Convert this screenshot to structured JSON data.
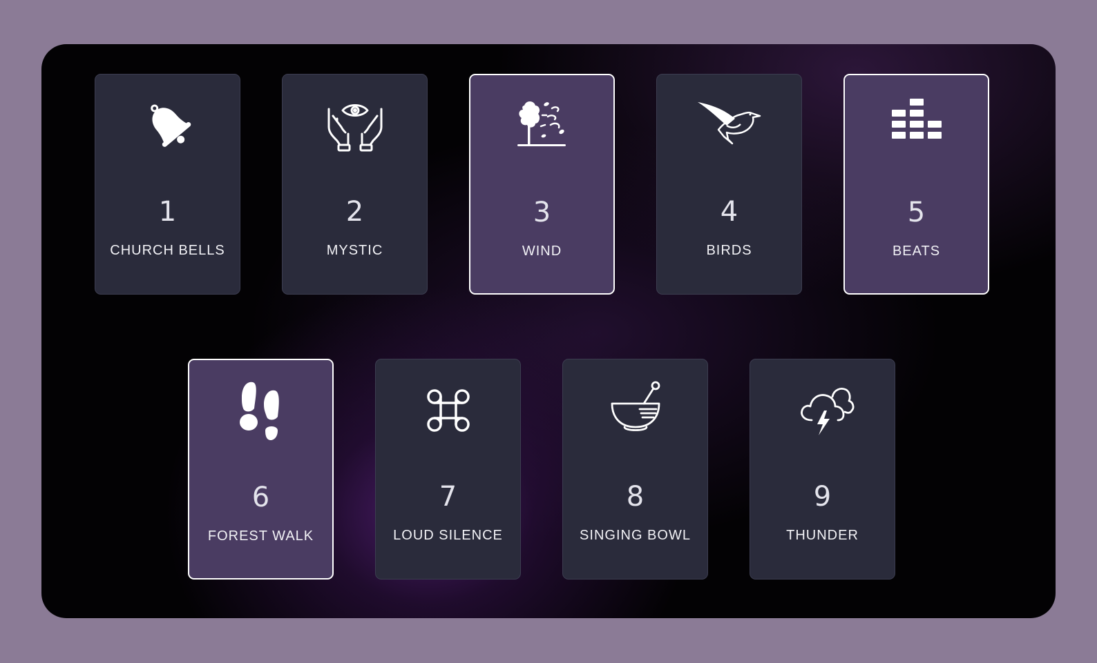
{
  "colors": {
    "page_background": "#8b7b96",
    "pad_default": "#2a2b3b",
    "pad_active": "#4a3c62",
    "pad_active_border": "#ffffff",
    "text": "#ffffff"
  },
  "pads": [
    {
      "number": "1",
      "label": "CHURCH BELLS",
      "icon": "bell-icon",
      "active": false
    },
    {
      "number": "2",
      "label": "MYSTIC",
      "icon": "hands-eye-icon",
      "active": false
    },
    {
      "number": "3",
      "label": "WIND",
      "icon": "wind-tree-icon",
      "active": true
    },
    {
      "number": "4",
      "label": "BIRDS",
      "icon": "dove-icon",
      "active": false
    },
    {
      "number": "5",
      "label": "BEATS",
      "icon": "equalizer-icon",
      "active": true
    },
    {
      "number": "6",
      "label": "FOREST WALK",
      "icon": "footprints-icon",
      "active": true
    },
    {
      "number": "7",
      "label": "LOUD SILENCE",
      "icon": "command-icon",
      "active": false
    },
    {
      "number": "8",
      "label": "SINGING BOWL",
      "icon": "mortar-pestle-icon",
      "active": false
    },
    {
      "number": "9",
      "label": "THUNDER",
      "icon": "thunder-cloud-icon",
      "active": false
    }
  ]
}
